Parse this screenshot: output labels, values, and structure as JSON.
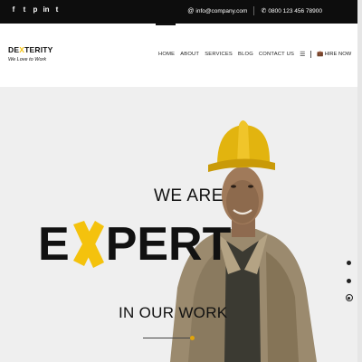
{
  "topbar": {
    "social_icons": [
      {
        "name": "facebook-icon",
        "glyph": "f"
      },
      {
        "name": "twitter-icon",
        "glyph": "t"
      },
      {
        "name": "pinterest-icon",
        "glyph": "p"
      },
      {
        "name": "linkedin-icon",
        "glyph": "in"
      },
      {
        "name": "tumblr-icon",
        "glyph": "t"
      }
    ],
    "email": "info@company.com",
    "phone": "0800 123 456 78900"
  },
  "logo": {
    "main_prefix": "DE",
    "main_x": "X",
    "main_suffix": "TERITY",
    "tagline": "We Love to Work"
  },
  "nav": {
    "items": [
      "HOME",
      "ABOUT",
      "SERVICES",
      "BLOG",
      "CONTACT US"
    ],
    "hire_label": "HIRE NOW"
  },
  "hero": {
    "line1": "WE ARE",
    "expert_prefix": "E",
    "expert_suffix": "PERT",
    "line3": "IN OUR WORK"
  },
  "colors": {
    "accent": "#f4c20d",
    "topbar": "#0d0d0d",
    "hero_bg": "#efefef"
  }
}
